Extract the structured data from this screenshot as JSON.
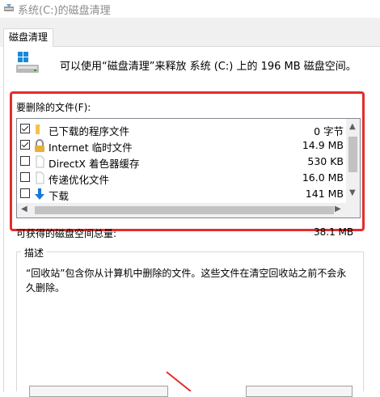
{
  "window": {
    "title": "系统(C:)的磁盘清理"
  },
  "tabs": [
    {
      "label": "磁盘清理"
    }
  ],
  "header": {
    "text": "可以使用“磁盘清理”来释放 系统 (C:) 上的 196 MB 磁盘空间。"
  },
  "files_section": {
    "label": "要删除的文件(F):",
    "items": [
      {
        "name": "已下载的程序文件",
        "size": "0 字节",
        "checked": true,
        "icon": "folder-icon"
      },
      {
        "name": "Internet 临时文件",
        "size": "14.9 MB",
        "checked": true,
        "icon": "lock-icon"
      },
      {
        "name": "DirectX 着色器缓存",
        "size": "530 KB",
        "checked": false,
        "icon": "file-icon"
      },
      {
        "name": "传递优化文件",
        "size": "16.0 MB",
        "checked": false,
        "icon": "file-icon"
      },
      {
        "name": "下载",
        "size": "141 MB",
        "checked": false,
        "icon": "download-arrow-icon"
      }
    ]
  },
  "total": {
    "label": "可获得的磁盘空间总量:",
    "value": "38.1 MB"
  },
  "description": {
    "label": "描述",
    "text": "“回收站”包含你从计算机中删除的文件。这些文件在清空回收站之前不会永久删除。"
  },
  "colors": {
    "highlight": "#e52b2b",
    "accent": "#0078d7",
    "folder": "#f6c24a"
  }
}
